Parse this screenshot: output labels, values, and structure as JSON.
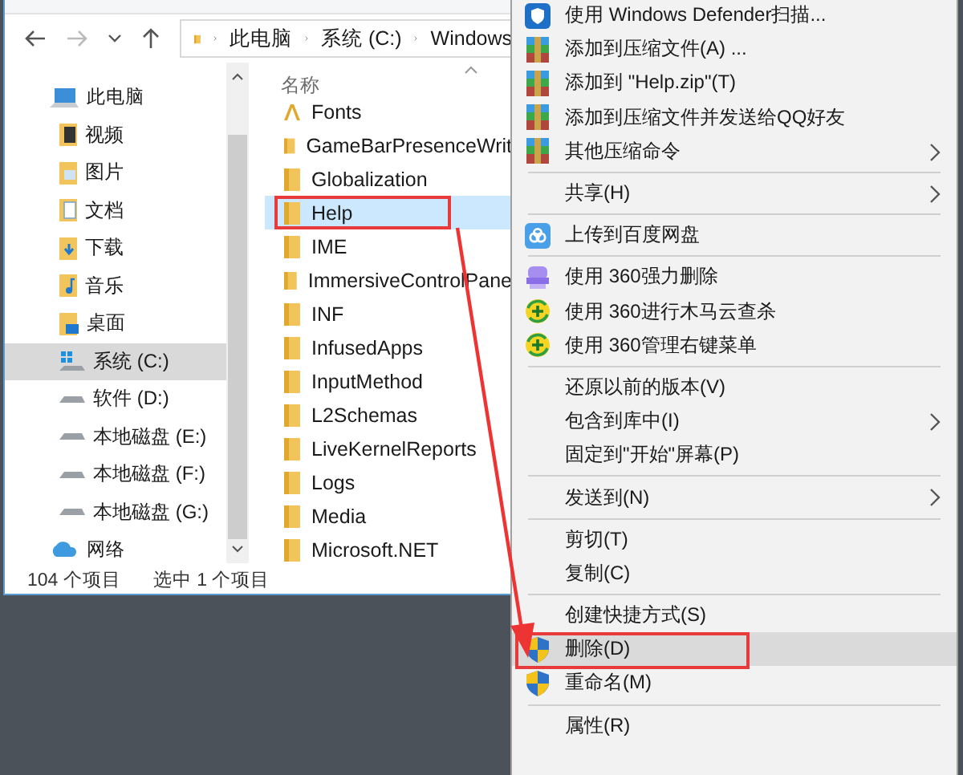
{
  "explorer": {
    "breadcrumb": [
      "此电脑",
      "系统 (C:)",
      "Windows"
    ],
    "sidebar": {
      "items": [
        {
          "label": "此电脑",
          "kind": "pc",
          "selected": false,
          "children": [
            {
              "label": "视频",
              "kind": "video",
              "selected": false
            },
            {
              "label": "图片",
              "kind": "picture",
              "selected": false
            },
            {
              "label": "文档",
              "kind": "document",
              "selected": false
            },
            {
              "label": "下载",
              "kind": "download",
              "selected": false
            },
            {
              "label": "音乐",
              "kind": "music",
              "selected": false
            },
            {
              "label": "桌面",
              "kind": "desktop",
              "selected": false
            },
            {
              "label": "系统 (C:)",
              "kind": "system_drive",
              "selected": true
            },
            {
              "label": "软件 (D:)",
              "kind": "drive",
              "selected": false
            },
            {
              "label": "本地磁盘 (E:)",
              "kind": "drive",
              "selected": false
            },
            {
              "label": "本地磁盘 (F:)",
              "kind": "drive",
              "selected": false
            },
            {
              "label": "本地磁盘 (G:)",
              "kind": "drive",
              "selected": false
            }
          ]
        },
        {
          "label": "网络",
          "kind": "network",
          "selected": false
        }
      ]
    },
    "column_header": "名称",
    "files": [
      {
        "name": "Fonts",
        "kind": "fonts",
        "selected": false,
        "marked": false
      },
      {
        "name": "GameBarPresenceWrit",
        "kind": "folder",
        "selected": false,
        "marked": false
      },
      {
        "name": "Globalization",
        "kind": "folder",
        "selected": false,
        "marked": false
      },
      {
        "name": "Help",
        "kind": "folder",
        "selected": true,
        "marked": true
      },
      {
        "name": "IME",
        "kind": "folder",
        "selected": false,
        "marked": false
      },
      {
        "name": "ImmersiveControlPane",
        "kind": "folder",
        "selected": false,
        "marked": false
      },
      {
        "name": "INF",
        "kind": "folder",
        "selected": false,
        "marked": false
      },
      {
        "name": "InfusedApps",
        "kind": "folder",
        "selected": false,
        "marked": false
      },
      {
        "name": "InputMethod",
        "kind": "folder",
        "selected": false,
        "marked": false
      },
      {
        "name": "L2Schemas",
        "kind": "folder",
        "selected": false,
        "marked": false
      },
      {
        "name": "LiveKernelReports",
        "kind": "folder",
        "selected": false,
        "marked": false
      },
      {
        "name": "Logs",
        "kind": "folder",
        "selected": false,
        "marked": false
      },
      {
        "name": "Media",
        "kind": "folder",
        "selected": false,
        "marked": false
      },
      {
        "name": "Microsoft.NET",
        "kind": "folder",
        "selected": false,
        "marked": false
      }
    ],
    "status": [
      "104 个项目",
      "选中 1 个项目"
    ]
  },
  "context_menu": {
    "items": [
      {
        "kind": "defender",
        "label": "使用 Windows Defender扫描...",
        "submenu": false,
        "selected": false,
        "marked": false
      },
      {
        "kind": "archive",
        "label": "添加到压缩文件(A) ...",
        "submenu": false,
        "selected": false,
        "marked": false
      },
      {
        "kind": "archive",
        "label": "添加到 \"Help.zip\"(T)",
        "submenu": false,
        "selected": false,
        "marked": false
      },
      {
        "kind": "archive",
        "label": "添加到压缩文件并发送给QQ好友",
        "submenu": false,
        "selected": false,
        "marked": false
      },
      {
        "kind": "archive",
        "label": "其他压缩命令",
        "submenu": true,
        "selected": false,
        "marked": false
      },
      {
        "kind": "separator"
      },
      {
        "kind": "item",
        "label": "共享(H)",
        "submenu": true,
        "selected": false,
        "marked": false
      },
      {
        "kind": "separator"
      },
      {
        "kind": "cloud",
        "label": "上传到百度网盘",
        "submenu": false,
        "selected": false,
        "marked": false
      },
      {
        "kind": "separator"
      },
      {
        "kind": "shredder",
        "label": "使用 360强力删除",
        "submenu": false,
        "selected": false,
        "marked": false
      },
      {
        "kind": "antivirus",
        "label": "使用 360进行木马云查杀",
        "submenu": false,
        "selected": false,
        "marked": false
      },
      {
        "kind": "antivirus",
        "label": "使用 360管理右键菜单",
        "submenu": false,
        "selected": false,
        "marked": false
      },
      {
        "kind": "separator"
      },
      {
        "kind": "item",
        "label": "还原以前的版本(V)",
        "submenu": false,
        "selected": false,
        "marked": false
      },
      {
        "kind": "item",
        "label": "包含到库中(I)",
        "submenu": true,
        "selected": false,
        "marked": false
      },
      {
        "kind": "item",
        "label": "固定到\"开始\"屏幕(P)",
        "submenu": false,
        "selected": false,
        "marked": false
      },
      {
        "kind": "separator"
      },
      {
        "kind": "item",
        "label": "发送到(N)",
        "submenu": true,
        "selected": false,
        "marked": false
      },
      {
        "kind": "separator"
      },
      {
        "kind": "item",
        "label": "剪切(T)",
        "submenu": false,
        "selected": false,
        "marked": false
      },
      {
        "kind": "item",
        "label": "复制(C)",
        "submenu": false,
        "selected": false,
        "marked": false
      },
      {
        "kind": "separator"
      },
      {
        "kind": "item",
        "label": "创建快捷方式(S)",
        "submenu": false,
        "selected": false,
        "marked": false
      },
      {
        "kind": "shield",
        "label": "删除(D)",
        "submenu": false,
        "selected": true,
        "marked": true
      },
      {
        "kind": "shield",
        "label": "重命名(M)",
        "submenu": false,
        "selected": false,
        "marked": false
      },
      {
        "kind": "separator"
      },
      {
        "kind": "item",
        "label": "属性(R)",
        "submenu": false,
        "selected": false,
        "marked": false
      }
    ]
  }
}
